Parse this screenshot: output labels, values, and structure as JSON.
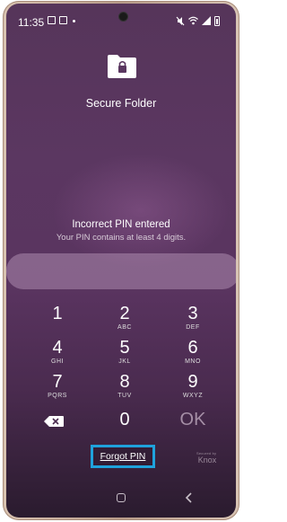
{
  "status_bar": {
    "time": "11:35"
  },
  "app": {
    "title": "Secure Folder",
    "icon": "folder-lock-icon"
  },
  "message": {
    "error": "Incorrect PIN entered",
    "hint": "Your PIN contains at least 4 digits."
  },
  "pin_input": {
    "value": ""
  },
  "keypad": {
    "k1": {
      "digit": "1",
      "letters": ""
    },
    "k2": {
      "digit": "2",
      "letters": "ABC"
    },
    "k3": {
      "digit": "3",
      "letters": "DEF"
    },
    "k4": {
      "digit": "4",
      "letters": "GHI"
    },
    "k5": {
      "digit": "5",
      "letters": "JKL"
    },
    "k6": {
      "digit": "6",
      "letters": "MNO"
    },
    "k7": {
      "digit": "7",
      "letters": "PQRS"
    },
    "k8": {
      "digit": "8",
      "letters": "TUV"
    },
    "k9": {
      "digit": "9",
      "letters": "WXYZ"
    },
    "k0": {
      "digit": "0",
      "letters": ""
    },
    "ok": "OK",
    "backspace_icon": "backspace-icon"
  },
  "forgot_pin": "Forgot PIN",
  "branding": {
    "small": "Secured by",
    "big": "Knox"
  },
  "colors": {
    "highlight": "#1fa2dc"
  }
}
